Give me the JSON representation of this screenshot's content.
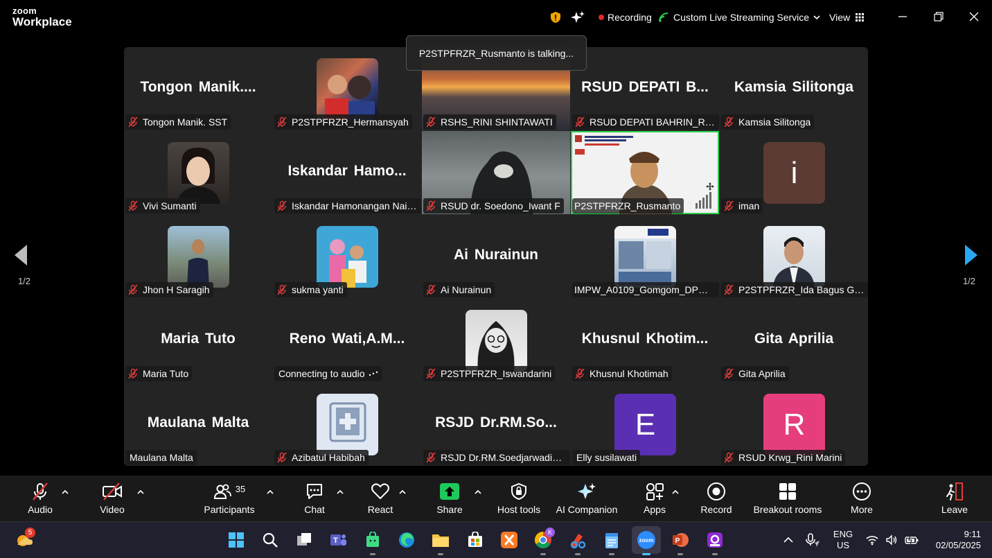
{
  "app": {
    "brand_line1": "zoom",
    "brand_line2": "Workplace"
  },
  "titlebar": {
    "recording_label": "Recording",
    "streaming_label": "Custom Live Streaming Service",
    "view_label": "View"
  },
  "toast": {
    "text": "P2STPFRZR_Rusmanto is talking..."
  },
  "pager": {
    "left_label": "1/2",
    "right_label": "1/2"
  },
  "tiles": [
    {
      "display": "Tongon  Manik....",
      "name": "Tongon Manik. SST"
    },
    {
      "name": "P2STPFRZR_Hermansyah"
    },
    {
      "name": "RSHS_RINI SHINTAWATI"
    },
    {
      "display": "RSUD  DEPATI  B...",
      "name": "RSUD DEPATI BAHRIN_Rahm..."
    },
    {
      "display": "Kamsia Silitonga",
      "name": "Kamsia Silitonga"
    },
    {
      "name": "Vivi Sumanti"
    },
    {
      "display": "Iskandar  Hamo...",
      "name": "Iskandar Hamonangan Naib..."
    },
    {
      "name": "RSUD dr. Soedono_Iwant F"
    },
    {
      "name": "P2STPFRZR_Rusmanto"
    },
    {
      "letter": "i",
      "name": "iman"
    },
    {
      "name": "Jhon H Saragih"
    },
    {
      "name": "sukma yanti"
    },
    {
      "display": "Ai Nurainun",
      "name": "Ai Nurainun"
    },
    {
      "name": "IMPW_A0109_Gomgom_DPW D..."
    },
    {
      "name": "P2STPFRZR_Ida Bagus Gede ..."
    },
    {
      "display": "Maria Tuto",
      "name": "Maria Tuto"
    },
    {
      "display": "Reno  Wati,A.M...",
      "name": "Connecting to audio"
    },
    {
      "name": "P2STPFRZR_Iswandarini"
    },
    {
      "display": "Khusnul  Khotim...",
      "name": "Khusnul Khotimah"
    },
    {
      "display": "Gita Aprilia",
      "name": "Gita Aprilia"
    },
    {
      "display": "Maulana Malta",
      "name": "Maulana Malta"
    },
    {
      "name": "Azibatul Habibah"
    },
    {
      "display": "RSJD  Dr.RM.So...",
      "name": "RSJD Dr.RM.Soedjarwadi_An..."
    },
    {
      "letter": "E",
      "name": "Elly susilawati"
    },
    {
      "letter": "R",
      "name": "RSUD Krwg_Rini Marini"
    }
  ],
  "toolbar": {
    "audio": "Audio",
    "video": "Video",
    "participants": "Participants",
    "participants_count": "35",
    "chat": "Chat",
    "react": "React",
    "share": "Share",
    "host_tools": "Host tools",
    "ai_companion": "AI Companion",
    "apps": "Apps",
    "record": "Record",
    "breakout": "Breakout rooms",
    "more": "More",
    "leave": "Leave"
  },
  "taskbar": {
    "weather_badge": "5",
    "chrome_badge": "K",
    "lang1": "ENG",
    "lang2": "US",
    "time": "9:11",
    "date": "02/05/2025"
  },
  "colors": {
    "accent_green": "#2ad04a",
    "record_red": "#e02828",
    "mute_red": "#e03c3c",
    "avatar_i": "#5b3b34",
    "avatar_e": "#5b2fb3",
    "avatar_r": "#e63e7d",
    "share_green": "#1fc85a",
    "nav_blue": "#27a8f3"
  }
}
